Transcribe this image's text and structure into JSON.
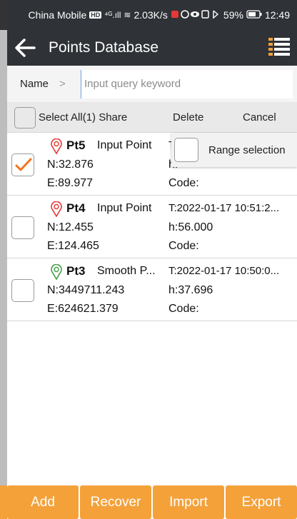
{
  "status_bar": {
    "carrier": "China Mobile",
    "hd_badge": "HD",
    "signal": "⁴ᴳ.ıll",
    "wifi": "≋",
    "speed": "2.03K/s",
    "battery": "59%",
    "time": "12:49"
  },
  "app_bar": {
    "title": "Points Database",
    "back_icon": "arrow-left-icon",
    "menu_icon": "list-menu-icon"
  },
  "search": {
    "field_label": "Name",
    "chevron": ">",
    "placeholder": "Input query keyword",
    "value": ""
  },
  "actions": {
    "select_all_label": "Select All(1) Share",
    "delete_label": "Delete",
    "cancel_label": "Cancel"
  },
  "range_selection": {
    "label": "Range selection",
    "checked": false
  },
  "points": [
    {
      "name": "Pt5",
      "type": "Input Point",
      "time": "T",
      "n": "N:32.876",
      "h": "h:",
      "e": "E:89.977",
      "code": "Code:",
      "checked": true,
      "pin_color": "#e53935"
    },
    {
      "name": "Pt4",
      "type": "Input Point",
      "time": "T:2022-01-17 10:51:2...",
      "n": "N:12.455",
      "h": "h:56.000",
      "e": "E:124.465",
      "code": "Code:",
      "checked": false,
      "pin_color": "#e53935"
    },
    {
      "name": "Pt3",
      "type": "Smooth P...",
      "time": "T:2022-01-17 10:50:0...",
      "n": "N:3449711.243",
      "h": "h:37.696",
      "e": "E:624621.379",
      "code": "Code:",
      "checked": false,
      "pin_color": "#43a047"
    }
  ],
  "bottom_bar": {
    "add_label": "Add",
    "recover_label": "Recover",
    "import_label": "Import",
    "export_label": "Export"
  },
  "colors": {
    "accent": "#f4a13a",
    "header": "#2f3237",
    "check": "#f4731c"
  }
}
